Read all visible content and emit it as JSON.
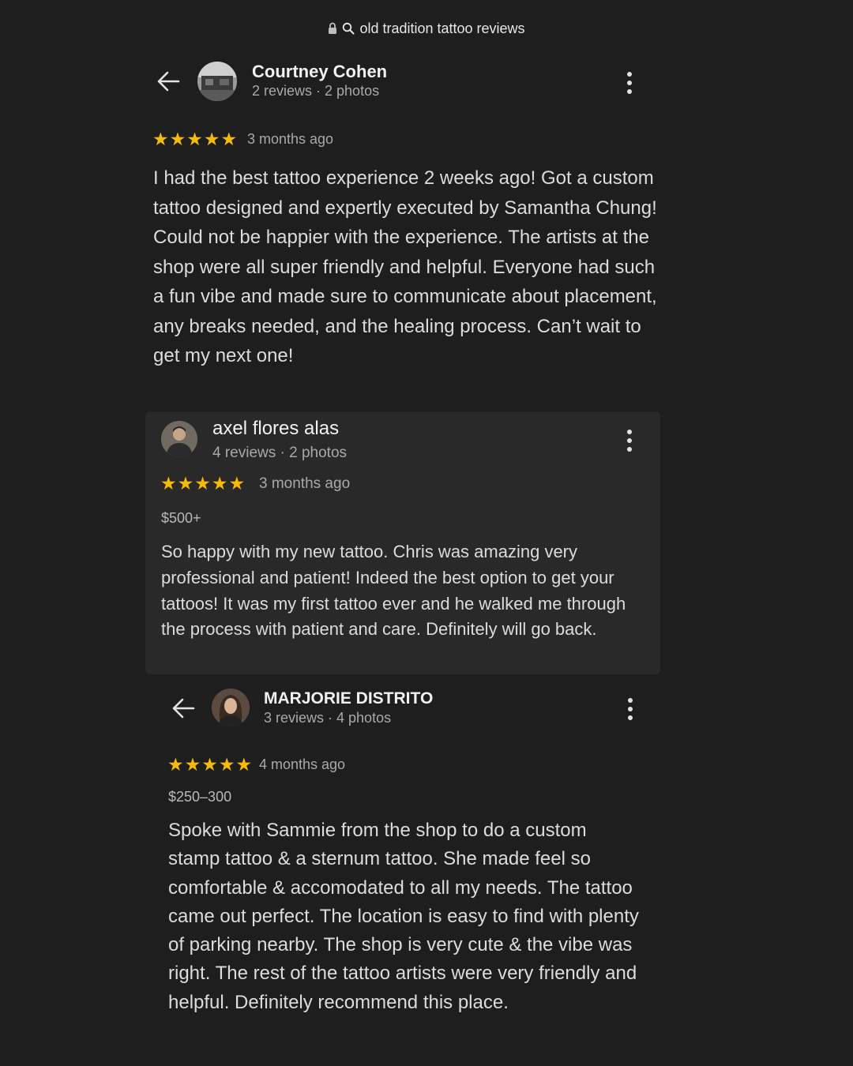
{
  "search": {
    "lock_icon": "lock-icon",
    "search_icon": "search-icon",
    "query": "old tradition tattoo reviews"
  },
  "colors": {
    "background": "#1e1e1e",
    "card": "#292929",
    "star": "#f6bb06",
    "text": "#dcdcdc",
    "muted": "#a9a9a9"
  },
  "reviews": [
    {
      "name": "Courtney Cohen",
      "meta": "2 reviews · 2 photos",
      "rating": 5,
      "stars": "★★★★★",
      "when": "3 months ago",
      "text": "I had the best tattoo experience 2 weeks ago! Got a custom tattoo designed and expertly executed by Samantha Chung! Could not be happier with the experience. The artists at the shop were all super friendly and helpful. Everyone had such a fun vibe and made sure to communicate about placement, any breaks needed, and the healing process. Can’t wait to get my next one!"
    },
    {
      "name": "axel flores alas",
      "meta": "4 reviews · 2 photos",
      "rating": 5,
      "stars": "★★★★★",
      "when": "3 months ago",
      "price": "$500+",
      "text": "So happy with my new tattoo. Chris was amazing very professional and patient! Indeed the best option to get your tattoos! It was my first tattoo ever and he walked me through the process with patient and care. Definitely will go back."
    },
    {
      "name": "MARJORIE DISTRITO",
      "meta": "3 reviews · 4 photos",
      "rating": 5,
      "stars": "★★★★★",
      "when": "4 months ago",
      "price": "$250–300",
      "text": "Spoke with Sammie from the shop to do a custom stamp tattoo & a sternum tattoo. She made feel so comfortable & accomodated to all my needs. The tattoo came out perfect. The location is easy to find with plenty of parking nearby. The shop is very cute & the vibe was right. The rest of the tattoo artists were very friendly and helpful. Definitely recommend this place."
    }
  ]
}
